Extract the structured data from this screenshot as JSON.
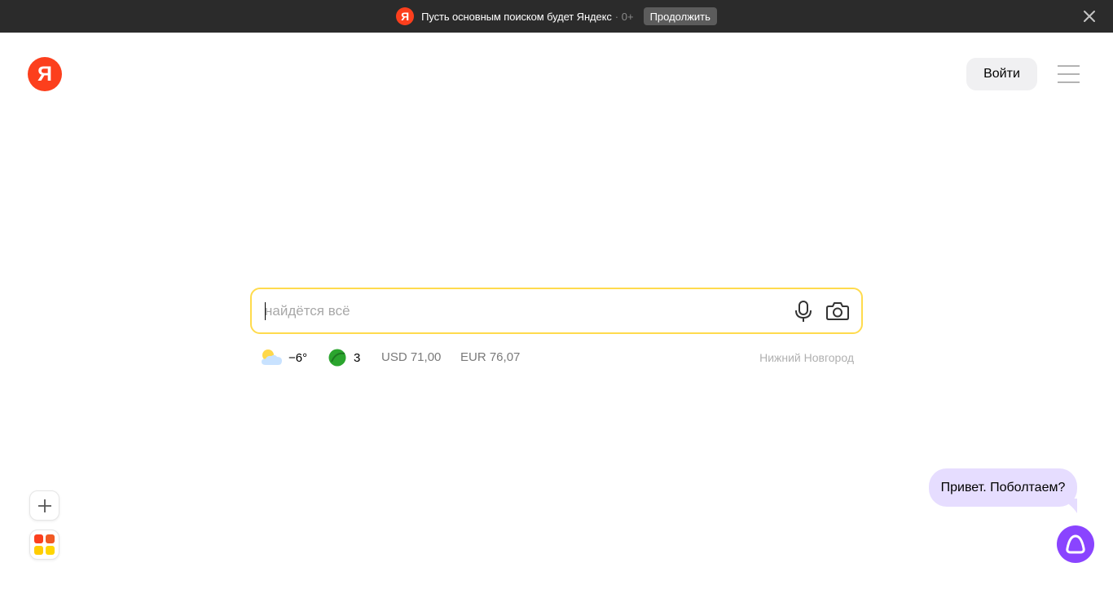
{
  "promo_banner": {
    "logo_letter": "Я",
    "text": "Пусть основным поиском будет Яндекс",
    "age_rating": "· 0+",
    "continue_label": "Продолжить",
    "close_icon": "close-icon",
    "background_color": "#2b2b2b"
  },
  "header": {
    "logo_letter": "Я",
    "logo_color": "#fc3f1d",
    "login_label": "Войти",
    "menu_icon": "hamburger-menu-icon"
  },
  "search": {
    "placeholder": "найдётся всё",
    "value": "",
    "border_color": "#ffdb4d",
    "mic_icon": "microphone-icon",
    "camera_icon": "camera-icon"
  },
  "informers": {
    "weather": {
      "icon": "partly-cloudy-icon",
      "temperature": "−6°"
    },
    "traffic": {
      "icon": "traffic-level-icon",
      "score": "3",
      "color": "#2ba52e"
    },
    "rates": {
      "usd": "USD 71,00",
      "eur": "EUR 76,07"
    },
    "city": "Нижний Новгород"
  },
  "widgets": {
    "add_icon": "plus-icon",
    "services_icon": "services-grid-icon"
  },
  "alice": {
    "greeting": "Привет. Поболтаем?",
    "bubble_color": "#e6ddff",
    "button_color": "#8a44ff",
    "icon": "alice-icon"
  }
}
